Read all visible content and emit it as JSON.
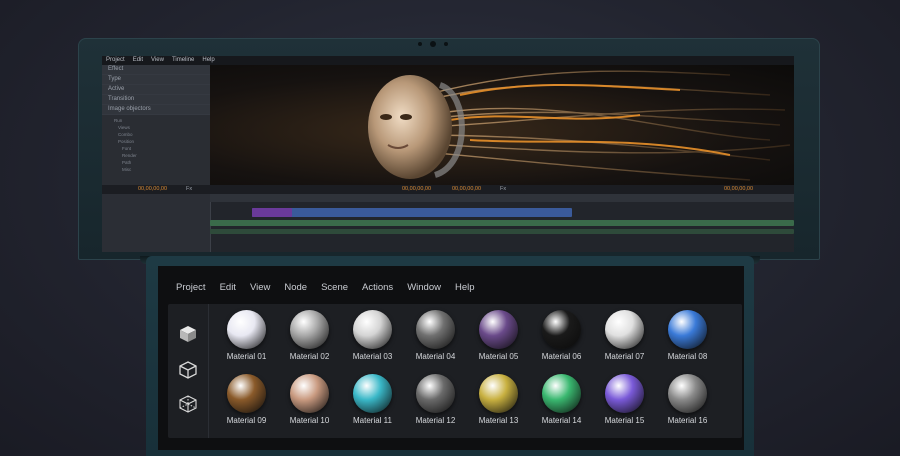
{
  "lid_app": {
    "menu": [
      "Project",
      "Edit",
      "View",
      "Timeline",
      "Help"
    ],
    "panel_rows": [
      "Effect",
      "Type",
      "Active",
      "Transition",
      "Image objectors"
    ],
    "tree": [
      "Run",
      "Views",
      "Combo",
      "Position",
      "Font",
      "Render",
      "Path",
      "Misc"
    ],
    "timecode_left": "00,00,00,00",
    "timecode_mid": "00,00,00,00",
    "timecode_mid2": "00,00,00,00",
    "timecode_right": "00,00,00,00",
    "fps_left": "Fx",
    "fps_right": "Fx"
  },
  "deck_app": {
    "menu": {
      "project": "Project",
      "edit": "Edit",
      "view": "View",
      "node": "Node",
      "scene": "Scene",
      "actions": "Actions",
      "window": "Window",
      "help": "Help"
    },
    "tools": [
      "cube-solid-icon",
      "cube-outline-icon",
      "cube-wireframe-icon"
    ],
    "materials": [
      {
        "label": "Material 01",
        "color": "#e8e8f2"
      },
      {
        "label": "Material 02",
        "color": "#a8a8a8"
      },
      {
        "label": "Material 03",
        "color": "#d4d4d4"
      },
      {
        "label": "Material 04",
        "color": "#707070"
      },
      {
        "label": "Material 05",
        "color": "#6a4a8a"
      },
      {
        "label": "Material 06",
        "color": "#1a1a1a"
      },
      {
        "label": "Material 07",
        "color": "#e0e0e0"
      },
      {
        "label": "Material 08",
        "color": "#3a7ad8"
      },
      {
        "label": "Material 09",
        "color": "#8a5a2a"
      },
      {
        "label": "Material 10",
        "color": "#c99a80"
      },
      {
        "label": "Material 11",
        "color": "#3ab8c8"
      },
      {
        "label": "Material 12",
        "color": "#6a6a6a"
      },
      {
        "label": "Material 13",
        "color": "#c8b040"
      },
      {
        "label": "Material 14",
        "color": "#3ab870"
      },
      {
        "label": "Material 15",
        "color": "#7a5ad8"
      },
      {
        "label": "Material 16",
        "color": "#8a8a8a"
      }
    ]
  }
}
